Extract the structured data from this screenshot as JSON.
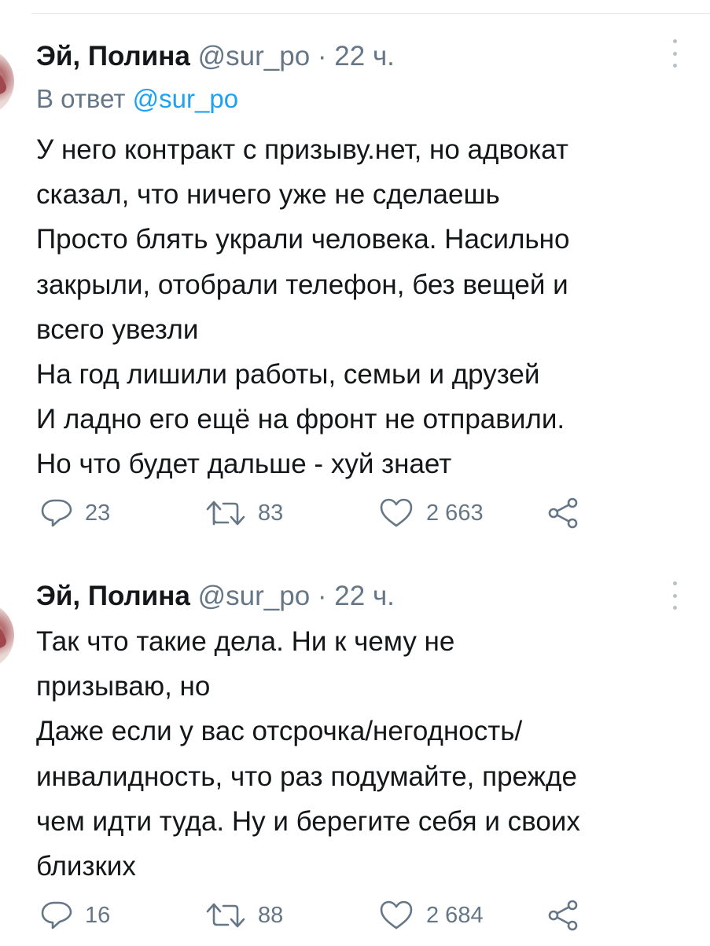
{
  "tweets": [
    {
      "display_name": "Эй, Полина",
      "handle": "@sur_po",
      "separator": "·",
      "time": "22 ч.",
      "reply_prefix": "В ответ",
      "reply_mention": "@sur_po",
      "lines": [
        "У него контракт с призыву.нет, но адвокат",
        "сказал, что ничего уже не сделаешь",
        "Просто блять украли человека. Насильно",
        "закрыли, отобрали телефон, без вещей и",
        "всего увезли",
        "На год лишили работы, семьи и друзей",
        "И ладно его ещё на фронт не отправили.",
        "Но что будет дальше - хуй знает"
      ],
      "replies": "23",
      "retweets": "83",
      "likes": "2 663"
    },
    {
      "display_name": "Эй, Полина",
      "handle": "@sur_po",
      "separator": "·",
      "time": "22 ч.",
      "lines": [
        "Так что такие дела. Ни к чему не",
        "призываю, но",
        "Даже если у вас отсрочка/негодность/",
        "инвалидность, что раз подумайте, прежде",
        "чем идти туда. Ну и берегите себя и своих",
        "близких"
      ],
      "replies": "16",
      "retweets": "88",
      "likes": "2 684"
    }
  ],
  "icons": {
    "menu": "more-vertical-icon",
    "reply": "reply-icon",
    "retweet": "retweet-icon",
    "like": "heart-icon",
    "share": "share-icon"
  },
  "colors": {
    "text": "#14171a",
    "secondary": "#657786",
    "link": "#1da1f2",
    "divider": "#e1e8ed"
  }
}
